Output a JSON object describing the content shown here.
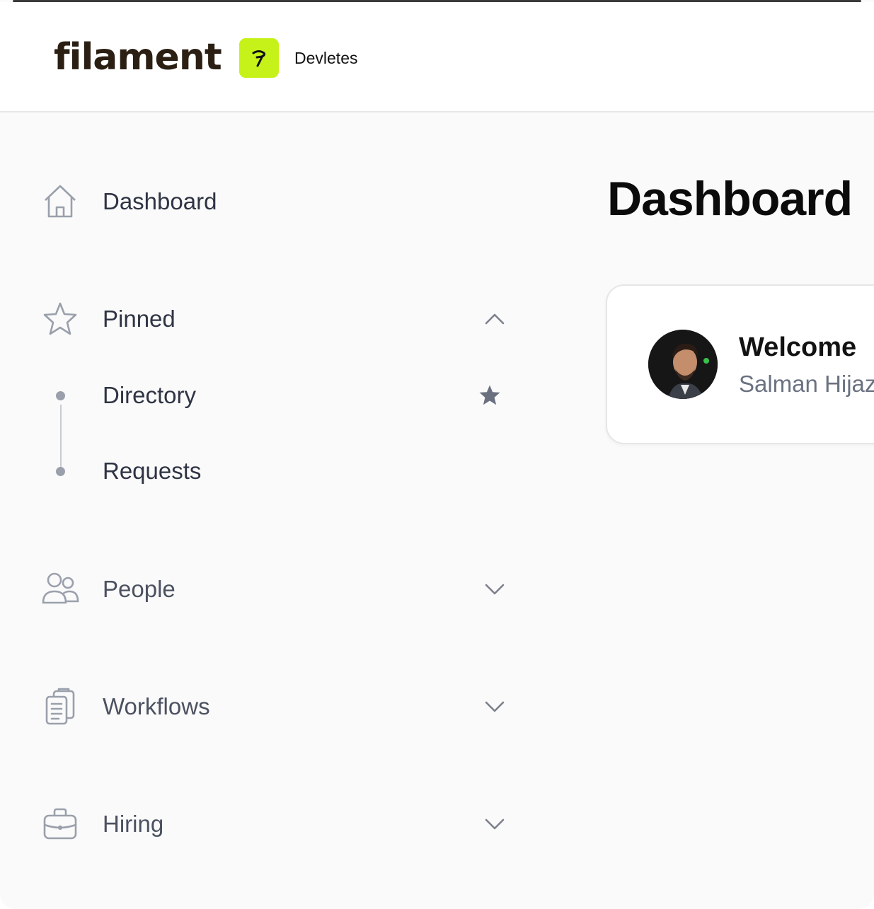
{
  "app": {
    "logo_text": "filament",
    "tenant_name": "Devletes",
    "tenant_color": "#c6f21a"
  },
  "sidebar": {
    "items": [
      {
        "label": "Dashboard",
        "icon": "home-icon"
      },
      {
        "label": "Pinned",
        "icon": "star-outline-icon",
        "expanded": true,
        "children": [
          {
            "label": "Directory",
            "pinned": true
          },
          {
            "label": "Requests",
            "pinned": false
          }
        ]
      },
      {
        "label": "People",
        "icon": "users-icon",
        "expanded": false
      },
      {
        "label": "Workflows",
        "icon": "clipboard-icon",
        "expanded": false
      },
      {
        "label": "Hiring",
        "icon": "briefcase-icon",
        "expanded": false
      }
    ]
  },
  "main": {
    "title": "Dashboard",
    "welcome": {
      "title": "Welcome",
      "name": "Salman Hijaz"
    }
  }
}
